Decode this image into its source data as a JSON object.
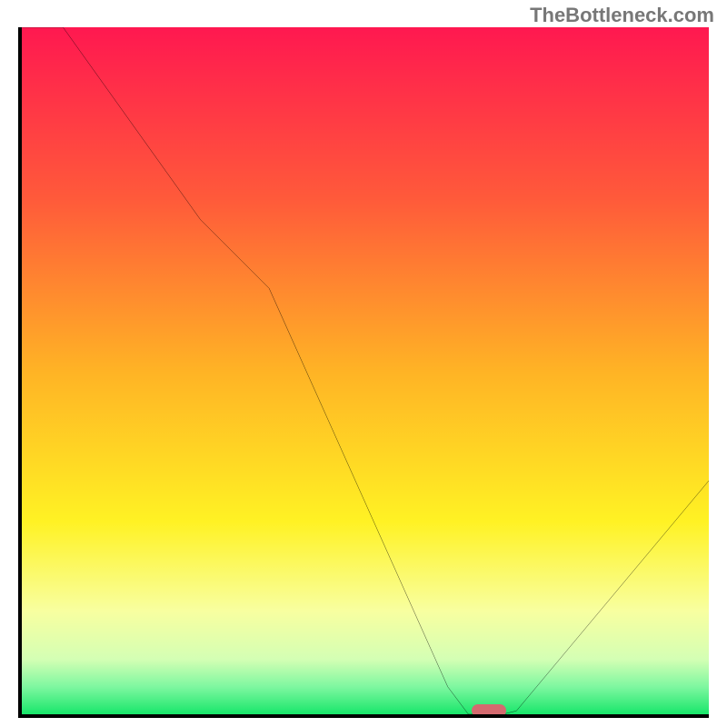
{
  "watermark": "TheBottleneck.com",
  "chart_data": {
    "type": "line",
    "title": "",
    "xlabel": "",
    "ylabel": "",
    "xlim": [
      0,
      100
    ],
    "ylim": [
      0,
      100
    ],
    "x": [
      0,
      6,
      26,
      36,
      62,
      65,
      70,
      72,
      100
    ],
    "y": [
      100,
      100,
      72,
      62,
      4,
      0,
      0,
      0.5,
      34
    ],
    "series": [
      {
        "name": "bottleneck-curve",
        "x": [
          0,
          6,
          26,
          36,
          62,
          65,
          70,
          72,
          100
        ],
        "y": [
          100,
          100,
          72,
          62,
          4,
          0,
          0,
          0.5,
          34
        ]
      }
    ],
    "gradient_stops": [
      {
        "pos": 0.0,
        "color": "#ff1850"
      },
      {
        "pos": 0.25,
        "color": "#ff5a3a"
      },
      {
        "pos": 0.5,
        "color": "#ffb325"
      },
      {
        "pos": 0.72,
        "color": "#fff224"
      },
      {
        "pos": 0.85,
        "color": "#f8ffa0"
      },
      {
        "pos": 0.92,
        "color": "#d4ffb4"
      },
      {
        "pos": 0.96,
        "color": "#7ef7a0"
      },
      {
        "pos": 1.0,
        "color": "#18e66a"
      }
    ],
    "marker": {
      "x": 68,
      "y": 0,
      "color": "#d46a6f"
    }
  }
}
